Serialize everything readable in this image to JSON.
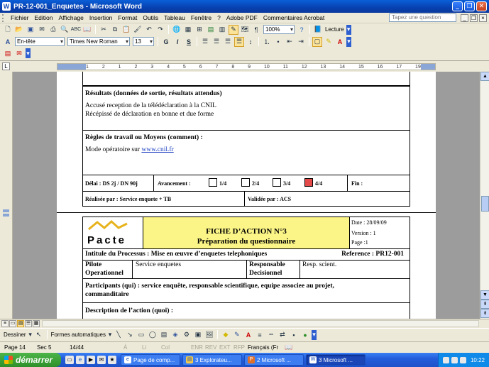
{
  "window": {
    "title": "PR-12-001_Enquetes - Microsoft Word"
  },
  "menu": {
    "items": [
      "Fichier",
      "Edition",
      "Affichage",
      "Insertion",
      "Format",
      "Outils",
      "Tableau",
      "Fenêtre",
      "?",
      "Adobe PDF",
      "Commentaires Acrobat"
    ],
    "ask_placeholder": "Tapez une question"
  },
  "toolbar": {
    "zoom": "100%",
    "read_label": "Lecture",
    "style": "En-tête",
    "font": "Times New Roman",
    "size": "13"
  },
  "ruler": {
    "ticks": [
      "1",
      "2",
      "1",
      "2",
      "3",
      "4",
      "5",
      "6",
      "7",
      "8",
      "9",
      "10",
      "11",
      "12",
      "13",
      "14",
      "15",
      "16",
      "17",
      "19"
    ]
  },
  "page1": {
    "results_heading": "Résultats (données de sortie, résultats attendus)",
    "results_line1": "Accusé reception de la télédéclaration à la CNIL",
    "results_line2": "Récépissé de déclaration en bonne et due forme",
    "rules_heading": "Règles de travail ou Moyens (comment) :",
    "rules_text": "Mode opératoire sur ",
    "rules_link": "www.cnil.fr",
    "delai": "Délai : DS 2j / DN 90j",
    "avancement": "Avancement :",
    "progress": [
      "1/4",
      "2/4",
      "3/4",
      "4/4"
    ],
    "fin": "Fin :",
    "realisee": "Réalisée par : Service enquete + TB",
    "validee": "Validée par : ACS"
  },
  "page2": {
    "logo_text": "Pacte",
    "fiche_title": "FICHE D’ACTION N°3",
    "fiche_subtitle": "Préparation du questionnaire",
    "date": "Date : 28/09/09",
    "version": "Version : 1",
    "page": "Page :1",
    "intitule": "Intitule du Processus : Mise en œuvre d’enquetes telephoniques",
    "reference": "Reference : PR12-001",
    "pilote_label1": "Pilote",
    "pilote_label2": "Operationnel",
    "pilote_value": "Service enquetes",
    "resp_label1": "Responsable",
    "resp_label2": "Decisionnel",
    "resp_value": "Resp. scient.",
    "participants_line1": "Participants  (qui) :  service  enquête,  responsable  scientifique,  equipe  associee  au  projet,",
    "participants_line2": "commanditaire",
    "description": "Description de l’action (quoi) :"
  },
  "drawbar": {
    "dessiner": "Dessiner",
    "formes": "Formes automatiques"
  },
  "status": {
    "page": "Page 14",
    "sec": "Sec 5",
    "pages": "14/44",
    "a": "À",
    "li": "Li",
    "col": "Col",
    "enr": "ENR",
    "rev": "REV",
    "ext": "EXT",
    "rfp": "RFP",
    "lang": "Français (Fr"
  },
  "taskbar": {
    "start": "démarrer",
    "tasks": [
      "Page de comp...",
      "3 Explorateu...",
      "2 Microsoft ...",
      "3 Microsoft ..."
    ],
    "clock": "10:22"
  }
}
